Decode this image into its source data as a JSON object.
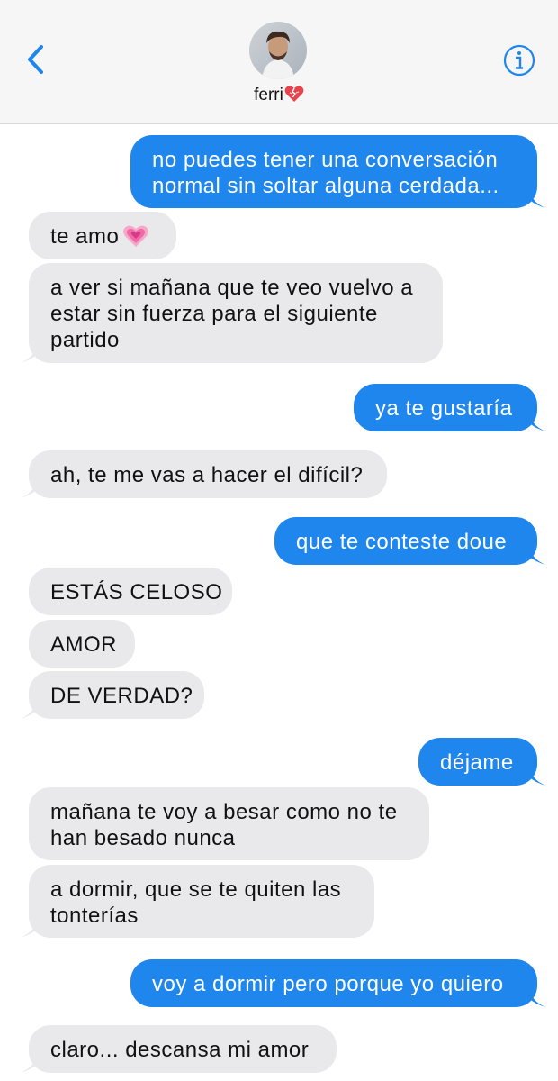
{
  "header": {
    "contact_name": "ferri",
    "contact_emoji": "mending-heart-icon"
  },
  "colors": {
    "accent": "#1f86ee",
    "sent_bubble": "#1f86ee",
    "received_bubble": "#e9e9eb",
    "header_bg": "#f6f6f7"
  },
  "messages": [
    {
      "from": "me",
      "lines": [
        "no puedes tener una conversación",
        "normal sin soltar alguna cerdada..."
      ]
    },
    {
      "from": "them",
      "lines": [
        "te amo"
      ],
      "emoji": "growing-heart-icon"
    },
    {
      "from": "them",
      "lines": [
        "a ver si mañana que te veo vuelvo a",
        "estar sin fuerza para el siguiente",
        "partido"
      ]
    },
    {
      "from": "me",
      "lines": [
        "ya te gustaría"
      ]
    },
    {
      "from": "them",
      "lines": [
        "ah, te me vas a hacer el difícil?"
      ]
    },
    {
      "from": "me",
      "lines": [
        "que te conteste doue"
      ]
    },
    {
      "from": "them",
      "lines": [
        "ESTÁS CELOSO"
      ]
    },
    {
      "from": "them",
      "lines": [
        "AMOR"
      ]
    },
    {
      "from": "them",
      "lines": [
        "DE VERDAD?"
      ]
    },
    {
      "from": "me",
      "lines": [
        "déjame"
      ]
    },
    {
      "from": "them",
      "lines": [
        "mañana te voy a besar como no te",
        "han besado nunca"
      ]
    },
    {
      "from": "them",
      "lines": [
        "a dormir, que se te quiten las",
        "tonterías"
      ]
    },
    {
      "from": "me",
      "lines": [
        "voy a dormir pero porque yo quiero"
      ]
    },
    {
      "from": "them",
      "lines": [
        "claro... descansa mi amor"
      ]
    }
  ]
}
